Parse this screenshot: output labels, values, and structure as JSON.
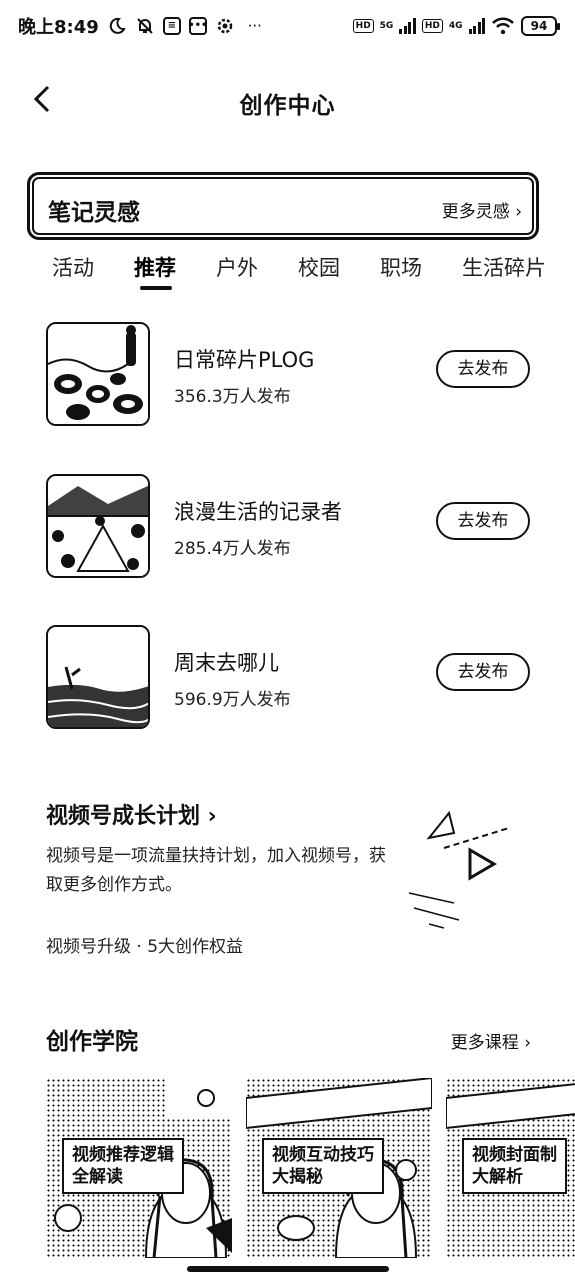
{
  "status_bar": {
    "time": "晚上8:49",
    "hd1": "HD",
    "net1": "5G",
    "hd2": "HD",
    "net2": "4G",
    "battery": "94"
  },
  "header": {
    "title": "创作中心"
  },
  "inspiration": {
    "title": "笔记灵感",
    "more": "更多灵感 ›"
  },
  "tabs": [
    {
      "label": "活动"
    },
    {
      "label": "推荐"
    },
    {
      "label": "户外"
    },
    {
      "label": "校园"
    },
    {
      "label": "职场"
    },
    {
      "label": "生活碎片"
    }
  ],
  "active_tab": "推荐",
  "topics": [
    {
      "name": "日常碎片PLOG",
      "count": "356.3万人发布",
      "button": "去发布"
    },
    {
      "name": "浪漫生活的记录者",
      "count": "285.4万人发布",
      "button": "去发布"
    },
    {
      "name": "周末去哪儿",
      "count": "596.9万人发布",
      "button": "去发布"
    }
  ],
  "video_plan": {
    "title": "视频号成长计划 ›",
    "description": "视频号是一项流量扶持计划，加入视频号，获取更多创作方式。",
    "benefit": "视频号升级 · 5大创作权益"
  },
  "academy": {
    "title": "创作学院",
    "more": "更多课程 ›",
    "courses": [
      {
        "line1": "视频推荐逻辑",
        "line2": "全解读"
      },
      {
        "line1": "视频互动技巧",
        "line2": "大揭秘"
      },
      {
        "line1": "视频封面制",
        "line2": "大解析"
      }
    ]
  }
}
